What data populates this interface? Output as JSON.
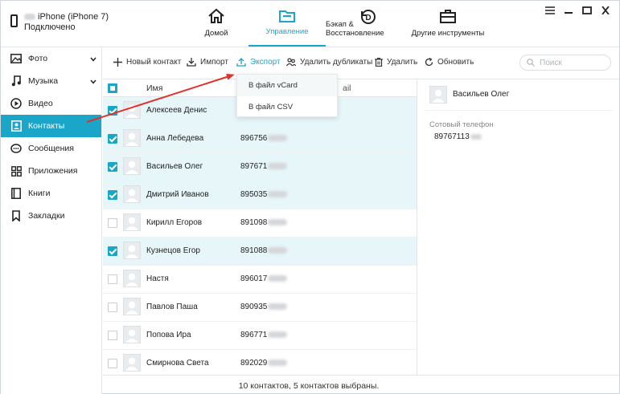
{
  "device": {
    "name": "iPhone (iPhone 7)",
    "status": "Подключено"
  },
  "nav": {
    "tabs": [
      {
        "label": "Домой",
        "icon": "home-icon"
      },
      {
        "label": "Управление",
        "icon": "folder-icon",
        "active": true
      },
      {
        "label": "Бэкап & Восстановление",
        "icon": "backup-restore-icon"
      },
      {
        "label": "Другие инструменты",
        "icon": "toolbox-icon"
      }
    ]
  },
  "sidebar": {
    "items": [
      {
        "label": "Фото",
        "icon": "photo-icon"
      },
      {
        "label": "Музыка",
        "icon": "music-icon"
      },
      {
        "label": "Видео",
        "icon": "video-icon"
      },
      {
        "label": "Контакты",
        "icon": "contacts-icon",
        "active": true
      },
      {
        "label": "Сообщения",
        "icon": "messages-icon"
      },
      {
        "label": "Приложения",
        "icon": "apps-icon"
      },
      {
        "label": "Книги",
        "icon": "books-icon"
      },
      {
        "label": "Закладки",
        "icon": "bookmark-icon"
      }
    ]
  },
  "toolbar": {
    "new_contact": "Новый контакт",
    "import": "Импорт",
    "export": "Экспорт",
    "dedupe": "Удалить дубликаты",
    "delete": "Удалить",
    "refresh": "Обновить",
    "search_placeholder": "Поиск"
  },
  "export_menu": {
    "vcard": "В файл vCard",
    "csv": "В файл CSV"
  },
  "table": {
    "header_name": "Имя",
    "header_phone": "ail",
    "rows": [
      {
        "name": "Алексеев Денис",
        "phone": "",
        "checked": true
      },
      {
        "name": "Анна Лебедева",
        "phone": "896756",
        "checked": true
      },
      {
        "name": "Васильев Олег",
        "phone": "897671",
        "checked": true
      },
      {
        "name": "Дмитрий Иванов",
        "phone": "895035",
        "checked": true
      },
      {
        "name": "Кирилл Егоров",
        "phone": "891098",
        "checked": false
      },
      {
        "name": "Кузнецов Егор",
        "phone": "891088",
        "checked": true
      },
      {
        "name": "Настя",
        "phone": "896017",
        "checked": false
      },
      {
        "name": "Павлов Паша",
        "phone": "890935",
        "checked": false
      },
      {
        "name": "Попова Ира",
        "phone": "896771",
        "checked": false
      },
      {
        "name": "Смирнова Света",
        "phone": "892029",
        "checked": false
      }
    ]
  },
  "detail": {
    "name": "Васильев Олег",
    "phone_label": "Сотовый телефон",
    "phone": "89767113"
  },
  "status": {
    "text": "10 контактов, 5 контактов выбраны."
  },
  "colors": {
    "accent": "#1aa6c9",
    "selected_row": "#e6f6f9",
    "arrow": "#e0312b"
  }
}
